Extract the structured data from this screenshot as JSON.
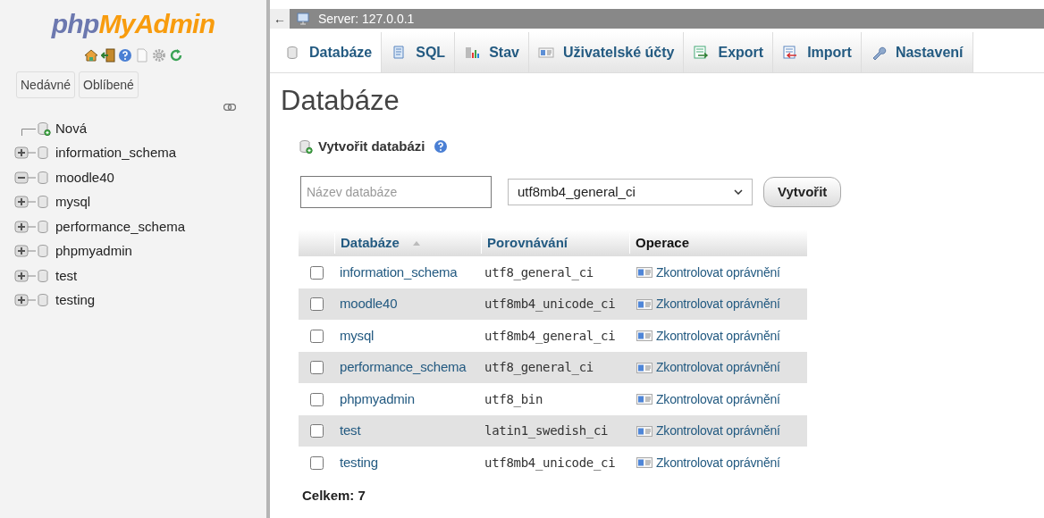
{
  "sidebar": {
    "logo": {
      "part_1": "php",
      "part_2": "MyAdmin"
    },
    "buttons": [
      "Nedávné",
      "Oblíbené"
    ],
    "tree": [
      {
        "name": "Nová",
        "kind": "new"
      },
      {
        "name": "information_schema",
        "kind": "db",
        "expanded": false
      },
      {
        "name": "moodle40",
        "kind": "db",
        "expanded": true
      },
      {
        "name": "mysql",
        "kind": "db",
        "expanded": false
      },
      {
        "name": "performance_schema",
        "kind": "db",
        "expanded": false
      },
      {
        "name": "phpmyadmin",
        "kind": "db",
        "expanded": false
      },
      {
        "name": "test",
        "kind": "db",
        "expanded": false
      },
      {
        "name": "testing",
        "kind": "db",
        "expanded": false
      }
    ]
  },
  "breadcrumb": {
    "back": "←",
    "server": "Server: 127.0.0.1"
  },
  "tabs": [
    {
      "label": "Databáze",
      "kind": "db",
      "selected": true
    },
    {
      "label": "SQL",
      "kind": "sql",
      "selected": false
    },
    {
      "label": "Stav",
      "kind": "status",
      "selected": false
    },
    {
      "label": "Uživatelské účty",
      "kind": "users",
      "selected": false
    },
    {
      "label": "Export",
      "kind": "export",
      "selected": false
    },
    {
      "label": "Import",
      "kind": "import",
      "selected": false
    },
    {
      "label": "Nastavení",
      "kind": "settings",
      "selected": false
    }
  ],
  "page_title": "Databáze",
  "create": {
    "title": "Vytvořit databázi",
    "name_field": {
      "placeholder": "Název databáze"
    },
    "collation": "utf8mb4_general_ci",
    "button": "Vytvořit"
  },
  "table": {
    "columns": [
      "Databáze",
      "Porovnávání",
      "Operace"
    ],
    "rows": [
      {
        "name": "information_schema",
        "collation": "utf8_general_ci",
        "action": "Zkontrolovat oprávnění",
        "checked": false
      },
      {
        "name": "moodle40",
        "collation": "utf8mb4_unicode_ci",
        "action": "Zkontrolovat oprávnění",
        "checked": false
      },
      {
        "name": "mysql",
        "collation": "utf8mb4_general_ci",
        "action": "Zkontrolovat oprávnění",
        "checked": false
      },
      {
        "name": "performance_schema",
        "collation": "utf8_general_ci",
        "action": "Zkontrolovat oprávnění",
        "checked": false
      },
      {
        "name": "phpmyadmin",
        "collation": "utf8_bin",
        "action": "Zkontrolovat oprávnění",
        "checked": false
      },
      {
        "name": "test",
        "collation": "latin1_swedish_ci",
        "action": "Zkontrolovat oprávnění",
        "checked": false
      },
      {
        "name": "testing",
        "collation": "utf8mb4_unicode_ci",
        "action": "Zkontrolovat oprávnění",
        "checked": false
      }
    ],
    "total": "Celkem: 7"
  }
}
